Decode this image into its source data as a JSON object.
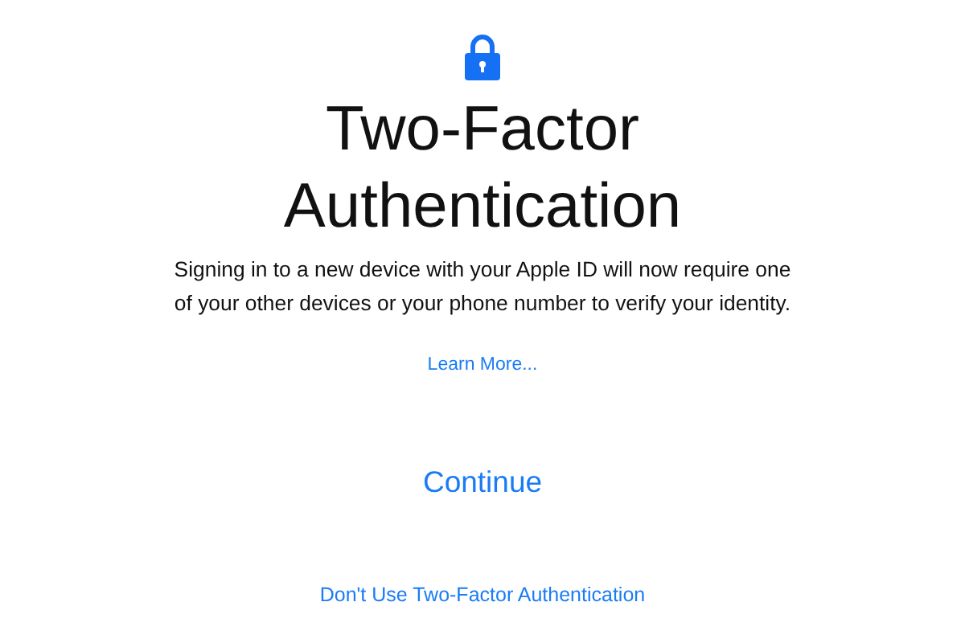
{
  "title_lines": [
    "Two-Factor",
    "Authentication"
  ],
  "description_lines": [
    "Signing in to a new device with your Apple ID will now require one",
    "of your other devices or your phone number to verify your identity."
  ],
  "learn_more_link": "Learn More...",
  "continue_button": "Continue",
  "decline_link": "Don't Use Two-Factor Authentication"
}
